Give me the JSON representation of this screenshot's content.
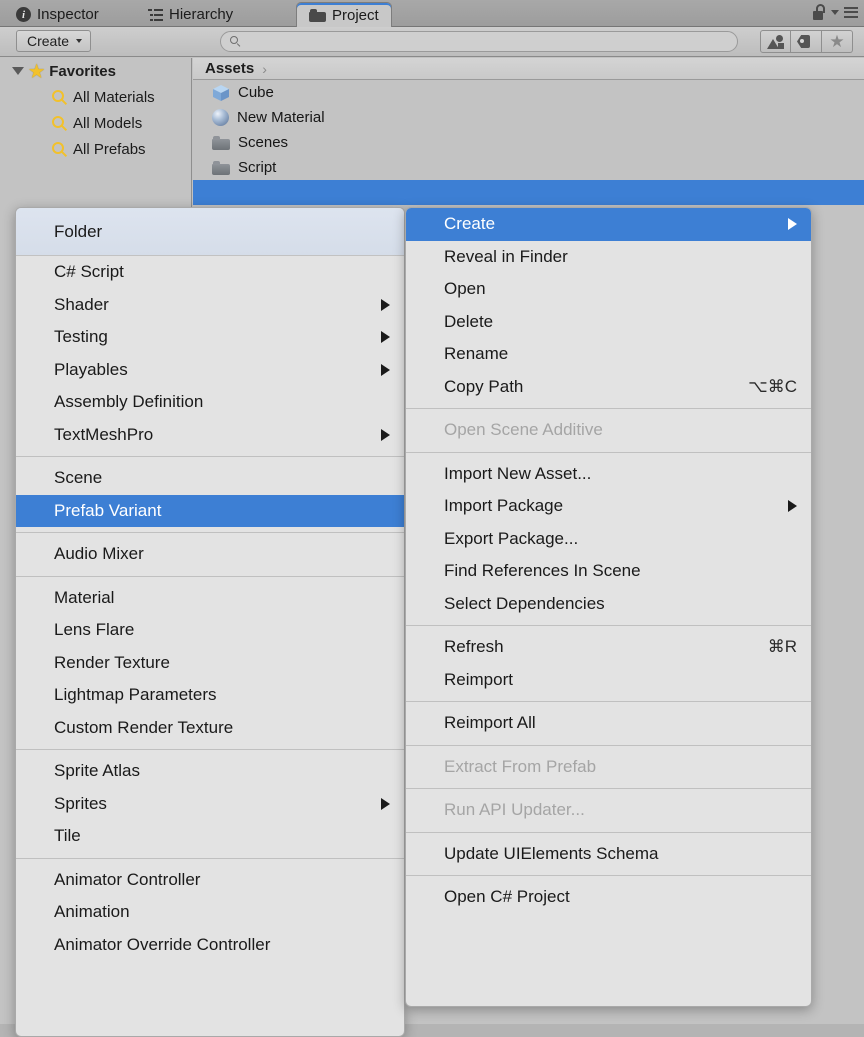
{
  "window": {
    "tabs": [
      {
        "label": "Inspector",
        "icon": "info-icon",
        "active": false
      },
      {
        "label": "Hierarchy",
        "icon": "hierarchy-icon",
        "active": false
      },
      {
        "label": "Project",
        "icon": "folder-icon",
        "active": true
      }
    ],
    "lock_icon": "lock-icon",
    "menu_icon": "hamburger-menu-icon"
  },
  "toolbar": {
    "create_label": "Create",
    "search_placeholder": "",
    "search_value": "",
    "search_icon": "search-icon",
    "buttons": [
      {
        "name": "filter-by-type-button",
        "icon": "shapes-icon"
      },
      {
        "name": "filter-by-label-button",
        "icon": "tag-icon"
      },
      {
        "name": "favorites-button",
        "icon": "star-icon"
      }
    ]
  },
  "sidebar": {
    "favorites_label": "Favorites",
    "items": [
      {
        "label": "All Materials",
        "icon": "search-icon"
      },
      {
        "label": "All Models",
        "icon": "search-icon"
      },
      {
        "label": "All Prefabs",
        "icon": "search-icon"
      }
    ]
  },
  "project": {
    "breadcrumb": "Assets",
    "breadcrumb_separator": "›",
    "assets": [
      {
        "label": "Cube",
        "icon": "cube-icon",
        "selected": false
      },
      {
        "label": "New Material",
        "icon": "sphere-icon",
        "selected": false
      },
      {
        "label": "Scenes",
        "icon": "folder-icon",
        "selected": false
      },
      {
        "label": "Script",
        "icon": "folder-icon",
        "selected": false
      }
    ]
  },
  "colors": {
    "accent": "#3d7fd4",
    "menu_bg": "#e3e3e3",
    "panel_bg": "#c3c3c3",
    "disabled_text": "#a5a5a5"
  },
  "create_menu": {
    "header": [
      {
        "label": "Folder",
        "arrow": false,
        "disabled": false,
        "selected": false
      }
    ],
    "groups": [
      [
        {
          "label": "C# Script",
          "arrow": false,
          "disabled": false,
          "selected": false
        },
        {
          "label": "Shader",
          "arrow": true,
          "disabled": false,
          "selected": false
        },
        {
          "label": "Testing",
          "arrow": true,
          "disabled": false,
          "selected": false
        },
        {
          "label": "Playables",
          "arrow": true,
          "disabled": false,
          "selected": false
        },
        {
          "label": "Assembly Definition",
          "arrow": false,
          "disabled": false,
          "selected": false
        },
        {
          "label": "TextMeshPro",
          "arrow": true,
          "disabled": false,
          "selected": false
        }
      ],
      [
        {
          "label": "Scene",
          "arrow": false,
          "disabled": false,
          "selected": false
        },
        {
          "label": "Prefab Variant",
          "arrow": false,
          "disabled": false,
          "selected": true
        }
      ],
      [
        {
          "label": "Audio Mixer",
          "arrow": false,
          "disabled": false,
          "selected": false
        }
      ],
      [
        {
          "label": "Material",
          "arrow": false,
          "disabled": false,
          "selected": false
        },
        {
          "label": "Lens Flare",
          "arrow": false,
          "disabled": false,
          "selected": false
        },
        {
          "label": "Render Texture",
          "arrow": false,
          "disabled": false,
          "selected": false
        },
        {
          "label": "Lightmap Parameters",
          "arrow": false,
          "disabled": false,
          "selected": false
        },
        {
          "label": "Custom Render Texture",
          "arrow": false,
          "disabled": false,
          "selected": false
        }
      ],
      [
        {
          "label": "Sprite Atlas",
          "arrow": false,
          "disabled": false,
          "selected": false
        },
        {
          "label": "Sprites",
          "arrow": true,
          "disabled": false,
          "selected": false
        },
        {
          "label": "Tile",
          "arrow": false,
          "disabled": false,
          "selected": false
        }
      ],
      [
        {
          "label": "Animator Controller",
          "arrow": false,
          "disabled": false,
          "selected": false
        },
        {
          "label": "Animation",
          "arrow": false,
          "disabled": false,
          "selected": false
        },
        {
          "label": "Animator Override Controller",
          "arrow": false,
          "disabled": false,
          "selected": false
        }
      ]
    ]
  },
  "context_menu": {
    "groups": [
      [
        {
          "label": "Create",
          "arrow": true,
          "disabled": false,
          "selected": true,
          "shortcut": ""
        },
        {
          "label": "Reveal in Finder",
          "arrow": false,
          "disabled": false,
          "selected": false,
          "shortcut": ""
        },
        {
          "label": "Open",
          "arrow": false,
          "disabled": false,
          "selected": false,
          "shortcut": ""
        },
        {
          "label": "Delete",
          "arrow": false,
          "disabled": false,
          "selected": false,
          "shortcut": ""
        },
        {
          "label": "Rename",
          "arrow": false,
          "disabled": false,
          "selected": false,
          "shortcut": ""
        },
        {
          "label": "Copy Path",
          "arrow": false,
          "disabled": false,
          "selected": false,
          "shortcut": "⌥⌘C"
        }
      ],
      [
        {
          "label": "Open Scene Additive",
          "arrow": false,
          "disabled": true,
          "selected": false,
          "shortcut": ""
        }
      ],
      [
        {
          "label": "Import New Asset...",
          "arrow": false,
          "disabled": false,
          "selected": false,
          "shortcut": ""
        },
        {
          "label": "Import Package",
          "arrow": true,
          "disabled": false,
          "selected": false,
          "shortcut": ""
        },
        {
          "label": "Export Package...",
          "arrow": false,
          "disabled": false,
          "selected": false,
          "shortcut": ""
        },
        {
          "label": "Find References In Scene",
          "arrow": false,
          "disabled": false,
          "selected": false,
          "shortcut": ""
        },
        {
          "label": "Select Dependencies",
          "arrow": false,
          "disabled": false,
          "selected": false,
          "shortcut": ""
        }
      ],
      [
        {
          "label": "Refresh",
          "arrow": false,
          "disabled": false,
          "selected": false,
          "shortcut": "⌘R"
        },
        {
          "label": "Reimport",
          "arrow": false,
          "disabled": false,
          "selected": false,
          "shortcut": ""
        }
      ],
      [
        {
          "label": "Reimport All",
          "arrow": false,
          "disabled": false,
          "selected": false,
          "shortcut": ""
        }
      ],
      [
        {
          "label": "Extract From Prefab",
          "arrow": false,
          "disabled": true,
          "selected": false,
          "shortcut": ""
        }
      ],
      [
        {
          "label": "Run API Updater...",
          "arrow": false,
          "disabled": true,
          "selected": false,
          "shortcut": ""
        }
      ],
      [
        {
          "label": "Update UIElements Schema",
          "arrow": false,
          "disabled": false,
          "selected": false,
          "shortcut": ""
        }
      ],
      [
        {
          "label": "Open C# Project",
          "arrow": false,
          "disabled": false,
          "selected": false,
          "shortcut": ""
        }
      ]
    ]
  }
}
